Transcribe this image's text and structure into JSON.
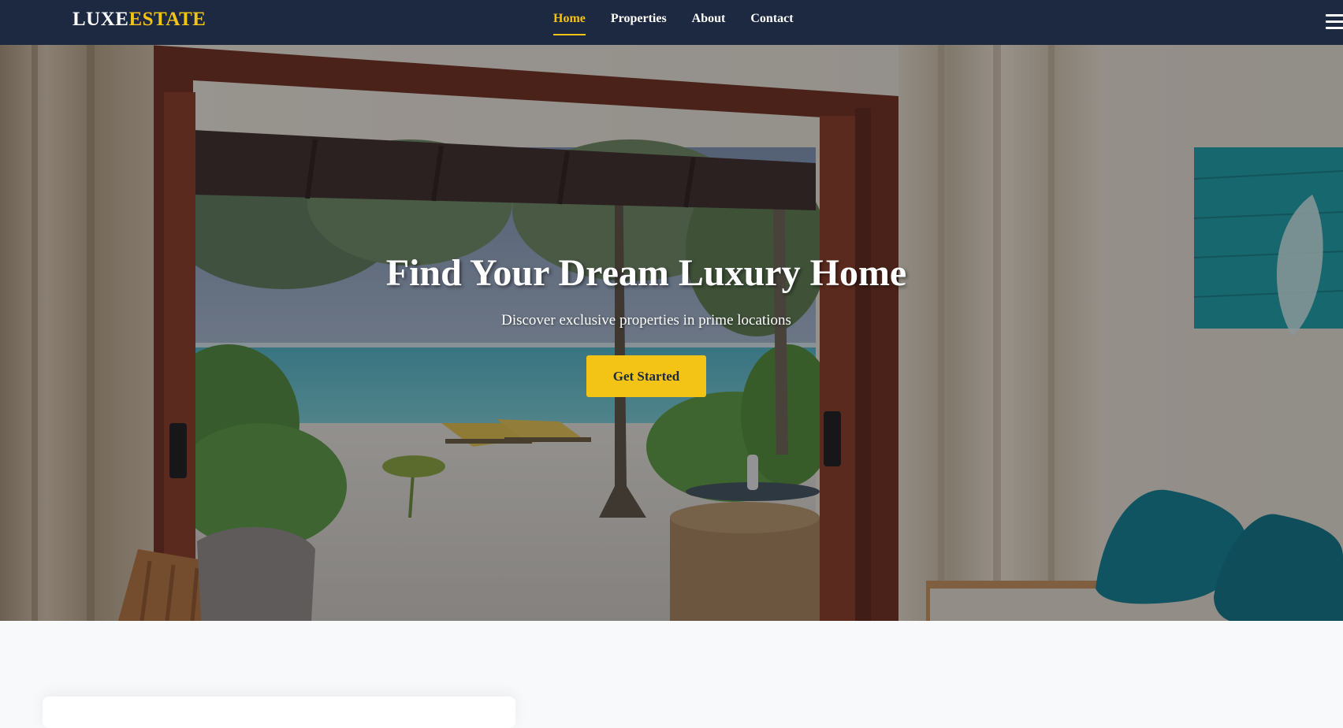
{
  "brand": {
    "logo_part1": "LUXE",
    "logo_part2": "ESTATE",
    "accent_color": "#f3c316",
    "nav_bg_color": "#1c2940"
  },
  "nav": {
    "links": [
      {
        "label": "Home",
        "active": true
      },
      {
        "label": "Properties",
        "active": false
      },
      {
        "label": "About",
        "active": false
      },
      {
        "label": "Contact",
        "active": false
      }
    ],
    "menu_icon": "hamburger-menu-icon"
  },
  "hero": {
    "title": "Find Your Dream Luxury Home",
    "subtitle": "Discover exclusive properties in prime locations",
    "cta_label": "Get Started",
    "background_image": "beach-villa-interior-view"
  }
}
